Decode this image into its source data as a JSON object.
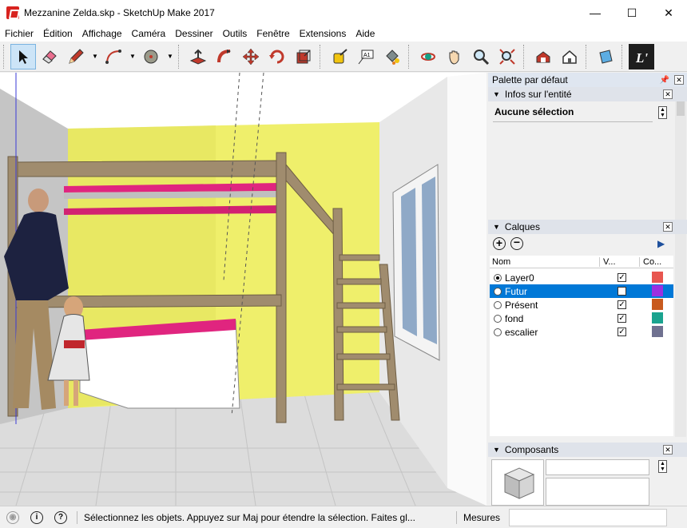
{
  "window": {
    "title": "Mezzanine Zelda.skp - SketchUp Make 2017",
    "minimize": "—",
    "maximize": "☐",
    "close": "✕"
  },
  "menu": [
    "Fichier",
    "Édition",
    "Affichage",
    "Caméra",
    "Dessiner",
    "Outils",
    "Fenêtre",
    "Extensions",
    "Aide"
  ],
  "toolbar": {
    "tools": [
      "select-icon",
      "eraser-icon",
      "pencil-icon",
      "arc-icon",
      "circle-icon",
      "push-pull-icon",
      "follow-me-icon",
      "move-icon",
      "rotate-icon",
      "scale-icon",
      "tape-measure-icon",
      "text-icon",
      "paint-bucket-icon",
      "orbit-icon",
      "pan-icon",
      "zoom-icon",
      "zoom-extents-icon",
      "warehouse-icon",
      "extension-warehouse-icon",
      "layout-icon"
    ]
  },
  "panel": {
    "tray_title": "Palette par défaut",
    "entity_info": {
      "title": "Infos sur l'entité",
      "selection": "Aucune sélection"
    },
    "layers": {
      "title": "Calques",
      "col_name": "Nom",
      "col_visible": "V...",
      "col_color": "Co...",
      "rows": [
        {
          "name": "Layer0",
          "active": true,
          "visible": true,
          "color": "#e8564f"
        },
        {
          "name": "Futur",
          "active": false,
          "visible": false,
          "color": "#9b30e0",
          "selected": true
        },
        {
          "name": "Présent",
          "active": false,
          "visible": true,
          "color": "#c85a1e"
        },
        {
          "name": "fond",
          "active": false,
          "visible": true,
          "color": "#1aa38f"
        },
        {
          "name": "escalier",
          "active": false,
          "visible": true,
          "color": "#6f7190"
        }
      ]
    },
    "components": {
      "title": "Composants"
    }
  },
  "status": {
    "message": "Sélectionnez les objets. Appuyez sur Maj pour étendre la sélection. Faites gl...",
    "measure_label": "Mesures",
    "measure_value": ""
  }
}
